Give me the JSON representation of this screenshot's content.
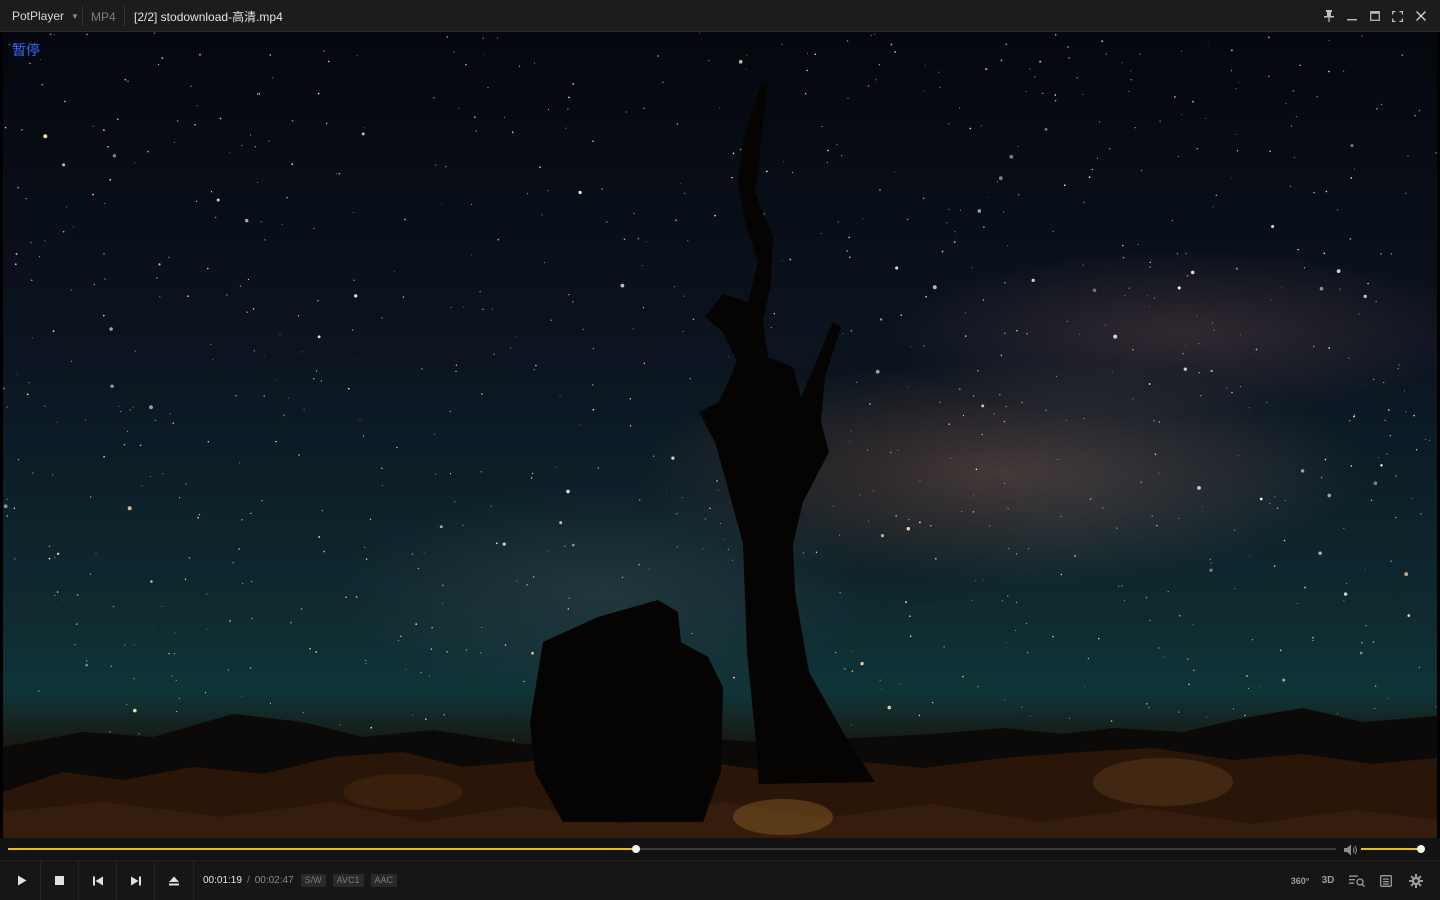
{
  "window": {
    "app_name": "PotPlayer",
    "format": "MP4",
    "title": "[2/2] stodownload-高清.mp4"
  },
  "osd": {
    "status": "暂停"
  },
  "playback": {
    "current_time": "00:01:19",
    "separator": "/",
    "duration": "00:02:47",
    "progress_fraction": 0.473,
    "volume_fraction": 1.0,
    "badges": [
      "S/W",
      "AVC1",
      "AAC"
    ]
  },
  "right_controls": {
    "vr_label": "360°",
    "threed_label": "3D"
  },
  "colors": {
    "accent": "#e2c21a",
    "osd_text": "#3a6cff",
    "bar_bg": "#161616"
  },
  "icons": [
    "play-icon",
    "stop-icon",
    "previous-icon",
    "next-icon",
    "eject-icon",
    "volume-icon",
    "pin-icon",
    "minimize-icon",
    "maximize-icon",
    "fullscreen-icon",
    "close-icon",
    "playlist-search-icon",
    "playlist-icon",
    "settings-icon"
  ]
}
